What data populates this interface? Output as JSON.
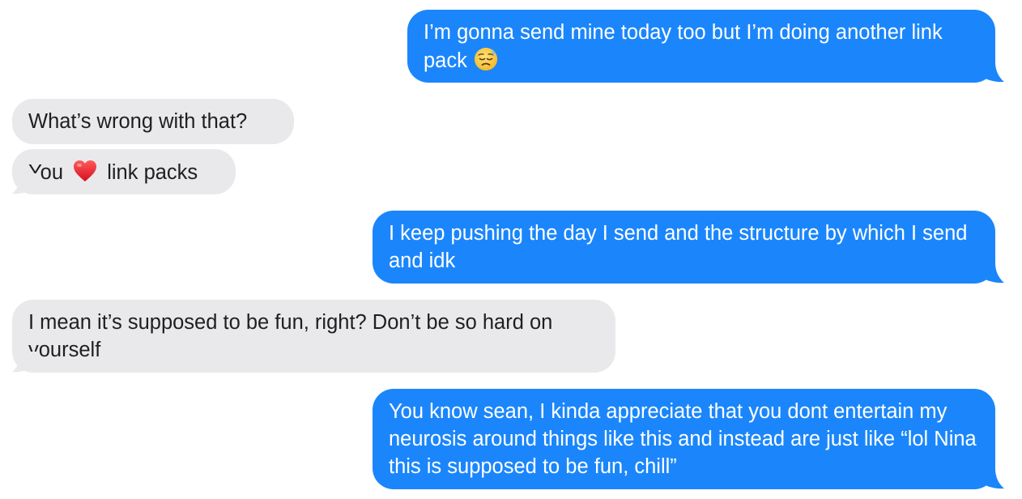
{
  "conversation": {
    "messages": [
      {
        "sender": "me",
        "text": "I’m gonna send mine today too but I’m doing another link pack",
        "emoji": "downcast-face-with-sweat"
      },
      {
        "sender": "them",
        "text": "What’s wrong with that?"
      },
      {
        "sender": "them",
        "text_before": "You",
        "emoji": "red-heart",
        "text_after": "link packs"
      },
      {
        "sender": "me",
        "text": "I keep pushing the day I send and the structure by which I send and idk"
      },
      {
        "sender": "them",
        "text": "I mean it’s supposed to be fun, right? Don’t be so hard on yourself"
      },
      {
        "sender": "me",
        "text": "You know sean, I kinda appreciate that you dont entertain my neurosis around things like this and instead are just like “lol Nina this is supposed to be fun, chill”"
      }
    ]
  },
  "colors": {
    "sent_bubble": "#1b86fb",
    "received_bubble": "#e9e9eb",
    "sent_text": "#ffffff",
    "received_text": "#1f1f1f"
  }
}
